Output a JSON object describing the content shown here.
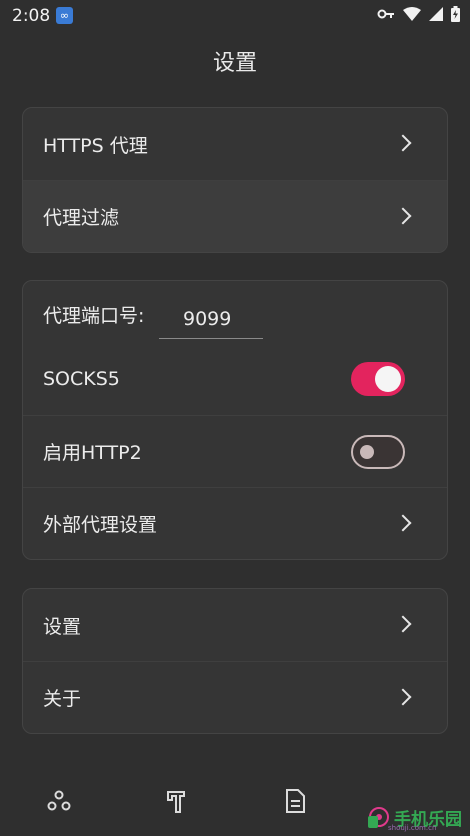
{
  "status": {
    "time": "2:08"
  },
  "title": "设置",
  "group1": {
    "https_proxy": "HTTPS 代理",
    "proxy_filter": "代理过滤"
  },
  "group2": {
    "port_label": "代理端口号:",
    "port_value": "9099",
    "socks5_label": "SOCKS5",
    "socks5_on": true,
    "http2_label": "启用HTTP2",
    "http2_on": false,
    "external_proxy": "外部代理设置"
  },
  "group3": {
    "settings": "设置",
    "about": "关于"
  },
  "bottom_nav": [
    "network-icon",
    "tools-icon",
    "document-icon",
    "settings-icon"
  ],
  "watermark": {
    "text": "手机乐园",
    "sub": "shouji.com.cn"
  },
  "colors": {
    "accent": "#e3245e",
    "background": "#2f2f2f",
    "card": "#353535"
  }
}
